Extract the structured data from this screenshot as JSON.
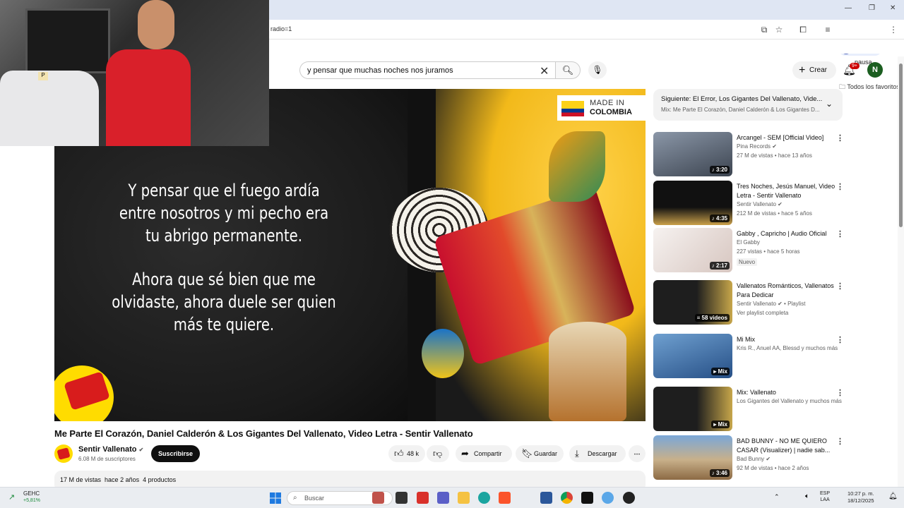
{
  "browser": {
    "url_fragment": "radio=1",
    "profile_initial": "K",
    "profile_status": "En pausa",
    "bookmarks_label": "Todos los favoritos"
  },
  "header": {
    "search_value": "y pensar que muchas noches nos juramos",
    "create_label": "Crear",
    "notifications_badge": "9+",
    "avatar_initial": "N"
  },
  "video": {
    "lyrics": [
      "Y pensar que el fuego ardía",
      "entre nosotros y mi pecho era",
      "tu abrigo permanente.",
      "Ahora que sé bien que me",
      "olvidaste, ahora duele ser quien",
      "más te quiere."
    ],
    "badge_line1": "MADE IN",
    "badge_line2": "COLOMBIA",
    "title": "Me Parte El Corazón, Daniel Calderón & Los Gigantes Del Vallenato, Video Letra - Sentir Vallenato"
  },
  "channel": {
    "name": "Sentir Vallenato",
    "subscribers": "6.08 M de suscriptores",
    "subscribe_label": "Suscribirse"
  },
  "actions": {
    "likes": "48 k",
    "share": "Compartir",
    "save": "Guardar",
    "download": "Descargar"
  },
  "description": {
    "views": "17 M de vistas",
    "age": "hace 2 años",
    "products": "4 productos"
  },
  "up_next": {
    "title": "Siguiente: El Error, Los Gigantes Del Vallenato, Vide...",
    "subtitle": "Mix: Me Parte El Corazón, Daniel Calderón & Los Gigantes D..."
  },
  "recommendations": [
    {
      "title": "Arcangel - SEM [Official Video]",
      "channel": "Pina Records",
      "meta": "27 M de vistas • hace 13 años",
      "duration": "3:20",
      "thumb_color": "#6d7a8c"
    },
    {
      "title": "Tres Noches, Jesús Manuel, Video Letra - Sentir Vallenato",
      "channel": "Sentir Vallenato",
      "meta": "212 M de vistas • hace 5 años",
      "duration": "4:35",
      "thumb_color": "#1d1d1d"
    },
    {
      "title": "Gabby , Capricho | Audio Oficial",
      "channel": "El Gabby",
      "meta": "227 vistas • hace 5 horas",
      "duration": "2:17",
      "badge": "Nuevo",
      "thumb_color": "#f4f0ee"
    },
    {
      "title": "Vallenatos Románticos, Vallenatos Para Dedicar",
      "channel": "Sentir Vallenato",
      "meta": "Ver playlist completa",
      "duration": "58 videos",
      "thumb_color": "#2a2a2a"
    },
    {
      "title": "Mi Mix",
      "channel": "Kris R., Anuel AA, Blessd y muchos más",
      "meta": "",
      "duration": "Mix",
      "thumb_color": "#3b6fa8"
    },
    {
      "title": "Mix: Vallenato",
      "channel": "Los Gigantes del Vallenato y muchos más",
      "meta": "",
      "duration": "Mix",
      "thumb_color": "#262626"
    },
    {
      "title": "BAD BUNNY - NO ME QUIERO CASAR (Visualizer) | nadie sab...",
      "channel": "Bad Bunny",
      "meta": "92 M de vistas • hace 2 años",
      "duration": "3:46",
      "thumb_color": "#b99a6c"
    }
  ],
  "taskbar": {
    "stock_name": "GEHC",
    "stock_change": "+5,81%",
    "search_placeholder": "Buscar",
    "lang_top": "ESP",
    "lang_bottom": "LAA",
    "time": "10:27 p. m.",
    "date": "18/12/2025"
  }
}
